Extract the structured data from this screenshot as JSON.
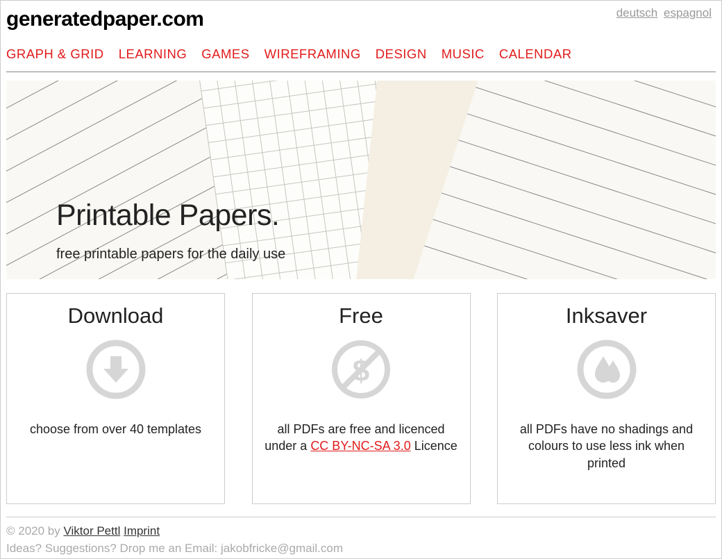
{
  "header": {
    "lang1": "deutsch",
    "lang2": "espagnol",
    "logo": "generatedpaper.com"
  },
  "nav": {
    "items": [
      "GRAPH & GRID",
      "LEARNING",
      "GAMES",
      "WIREFRAMING",
      "DESIGN",
      "MUSIC",
      "CALENDAR"
    ]
  },
  "hero": {
    "title": "Printable Papers.",
    "subtitle": "free printable papers for the daily use"
  },
  "cards": [
    {
      "title": "Download",
      "text": "choose from over 40 templates"
    },
    {
      "title": "Free",
      "text_before": "all PDFs are free and licenced under a ",
      "link_text": "CC BY-NC-SA 3.0",
      "text_after": " Licence"
    },
    {
      "title": "Inksaver",
      "text": "all PDFs have no shadings and colours to use less ink when printed"
    }
  ],
  "footer": {
    "copyright_pre": "© 2020 by ",
    "author": "Viktor Pettl",
    "imprint": "Imprint",
    "line2": "Ideas? Suggestions? Drop me an Email: jakobfricke@gmail.com"
  },
  "colors": {
    "accent": "#e11b1b",
    "muted": "#aaaaaa"
  }
}
